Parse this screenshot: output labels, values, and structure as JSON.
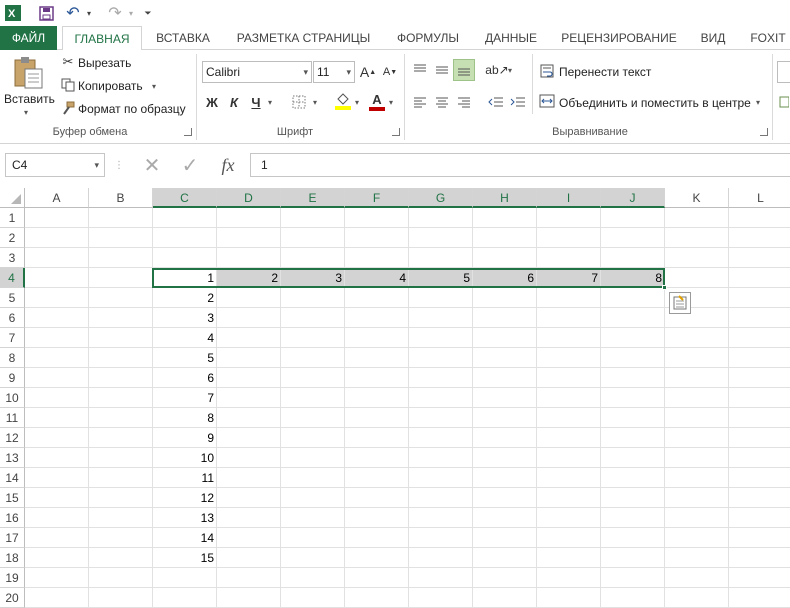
{
  "quick_access": {
    "undo_glyph": "↶",
    "redo_glyph": "↷",
    "more_glyph": "⏷"
  },
  "tabs": [
    "ФАЙЛ",
    "ГЛАВНАЯ",
    "ВСТАВКА",
    "РАЗМЕТКА СТРАНИЦЫ",
    "ФОРМУЛЫ",
    "ДАННЫЕ",
    "РЕЦЕНЗИРОВАНИЕ",
    "ВИД",
    "FOXIT"
  ],
  "active_tab": "ГЛАВНАЯ",
  "ribbon": {
    "clipboard": {
      "paste_label": "Вставить",
      "cut_label": "Вырезать",
      "copy_label": "Копировать",
      "format_painter_label": "Формат по образцу",
      "group_label": "Буфер обмена"
    },
    "font": {
      "font_name": "Calibri",
      "font_size": "11",
      "bold": "Ж",
      "italic": "К",
      "underline": "Ч",
      "group_label": "Шрифт",
      "grow": "A",
      "shrink": "A"
    },
    "alignment": {
      "wrap_text_label": "Перенести текст",
      "merge_label": "Объединить и поместить в центре",
      "group_label": "Выравнивание"
    }
  },
  "formula_bar": {
    "name_box": "C4",
    "fx": "fx",
    "formula_value": "1"
  },
  "sheet": {
    "columns": [
      "A",
      "B",
      "C",
      "D",
      "E",
      "F",
      "G",
      "H",
      "I",
      "J",
      "K",
      "L"
    ],
    "rows": [
      "1",
      "2",
      "3",
      "4",
      "5",
      "6",
      "7",
      "8",
      "9",
      "10",
      "11",
      "12",
      "13",
      "14",
      "15",
      "16",
      "17",
      "18",
      "19",
      "20"
    ],
    "selected_columns": [
      "C",
      "D",
      "E",
      "F",
      "G",
      "H",
      "I",
      "J"
    ],
    "selected_row": "4",
    "row4_values": {
      "C": "1",
      "D": "2",
      "E": "3",
      "F": "4",
      "G": "5",
      "H": "6",
      "I": "7",
      "J": "8"
    },
    "columnC_values": {
      "5": "2",
      "6": "3",
      "7": "4",
      "8": "5",
      "9": "6",
      "10": "7",
      "11": "8",
      "12": "9",
      "13": "10",
      "14": "11",
      "15": "12",
      "16": "13",
      "17": "14",
      "18": "15"
    }
  },
  "colors": {
    "accent": "#217346",
    "selection_fill": "#d3d3d3",
    "font_color_bar": "#c00000",
    "highlight_bar": "#ffff00"
  }
}
